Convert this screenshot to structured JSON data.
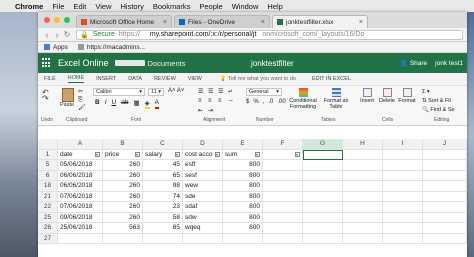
{
  "menubar": {
    "apple": "",
    "items": [
      "Chrome",
      "File",
      "Edit",
      "View",
      "History",
      "Bookmarks",
      "People",
      "Window",
      "Help"
    ]
  },
  "tabs": [
    {
      "label": "Microsoft Office Home",
      "icon": "office-icon",
      "color": "#e7491f",
      "active": false
    },
    {
      "label": "Files - OneDrive",
      "icon": "onedrive-icon",
      "color": "#0a64c7",
      "active": false
    },
    {
      "label": "jonktestfilter.xlsx",
      "icon": "excel-icon",
      "color": "#217346",
      "active": true
    }
  ],
  "address": {
    "secure": "Secure",
    "base": "https://",
    "host": "my.sharepoint.com/:x:/r/personal/jt",
    "path": "onmicrosoft_com/_layouts/16/Do"
  },
  "bookmarks": {
    "apps": "Apps",
    "link": "https://macadmins..."
  },
  "excel": {
    "app_name": "Excel Online",
    "crumb": "Documents",
    "filename": "jonktestfilter",
    "share": "Share",
    "user": "jonk test1"
  },
  "ribbon_tabs": [
    "FILE",
    "HOME",
    "INSERT",
    "DATA",
    "REVIEW",
    "VIEW"
  ],
  "active_ribbon_tab": "HOME",
  "tell_me": "Tell me what you want to do",
  "edit_in_excel": "EDIT IN EXCEL",
  "ribbon": {
    "undo": "Undo",
    "paste": "Paste",
    "clipboard": "Clipboard",
    "font_name": "Calibri",
    "font_size": "11",
    "font_group": "Font",
    "alignment_group": "Alignment",
    "number_format": "General",
    "number_group": "Number",
    "conditional_formatting": "Conditional Formatting",
    "format_as_table": "Format as Table",
    "tables_group": "Tables",
    "insert": "Insert",
    "delete": "Delete",
    "format": "Format",
    "cells_group": "Cells",
    "sort_filter": "Sort & Fil",
    "find_select": "Find & Se",
    "editing_group": "Editing"
  },
  "grid": {
    "columns": [
      "A",
      "B",
      "C",
      "D",
      "E",
      "F",
      "G",
      "H",
      "I",
      "J"
    ],
    "selected_column": "G",
    "rows": [
      {
        "n": "1",
        "cells": [
          "date",
          "price",
          "salary",
          "cost accou",
          "sum",
          "",
          "",
          "",
          "",
          ""
        ],
        "header": true
      },
      {
        "n": "5",
        "cells": [
          "05/06/2018",
          "260",
          "45",
          "esff",
          "800",
          "",
          "",
          "",
          "",
          ""
        ]
      },
      {
        "n": "6",
        "cells": [
          "06/06/2018",
          "260",
          "65",
          "sesf",
          "800",
          "",
          "",
          "",
          "",
          ""
        ]
      },
      {
        "n": "18",
        "cells": [
          "06/06/2018",
          "260",
          "98",
          "wew",
          "800",
          "",
          "",
          "",
          "",
          ""
        ]
      },
      {
        "n": "21",
        "cells": [
          "07/06/2018",
          "260",
          "74",
          "sde",
          "800",
          "",
          "",
          "",
          "",
          ""
        ]
      },
      {
        "n": "22",
        "cells": [
          "07/06/2018",
          "260",
          "23",
          "sdaf",
          "800",
          "",
          "",
          "",
          "",
          ""
        ]
      },
      {
        "n": "25",
        "cells": [
          "09/06/2018",
          "260",
          "58",
          "sdw",
          "800",
          "",
          "",
          "",
          "",
          ""
        ]
      },
      {
        "n": "26",
        "cells": [
          "25/06/2018",
          "563",
          "85",
          "wqeq",
          "800",
          "",
          "",
          "",
          "",
          ""
        ]
      },
      {
        "n": "27",
        "cells": [
          "",
          "",
          "",
          "",
          "",
          "",
          "",
          "",
          "",
          ""
        ]
      }
    ]
  },
  "colors": {
    "excel_green": "#217346",
    "selected_header": "#d3e8da"
  }
}
